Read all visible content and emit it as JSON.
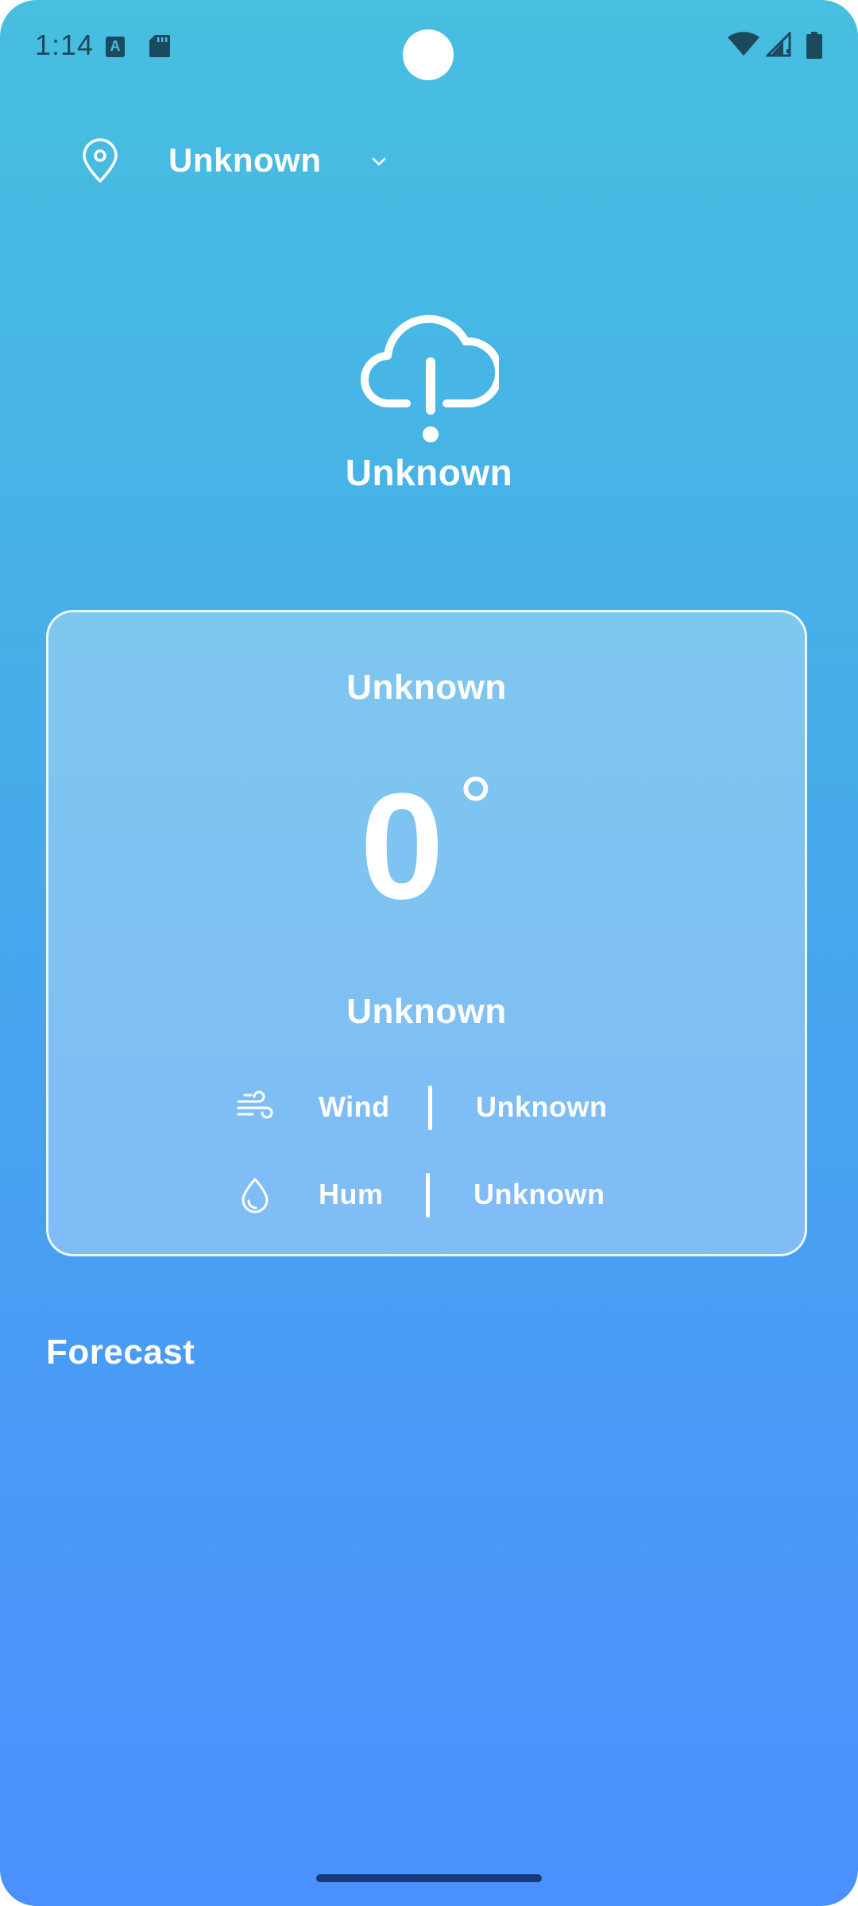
{
  "status_bar": {
    "time": "1:14",
    "keyboard_badge": "A",
    "icons": [
      "sd-card-icon",
      "wifi-icon",
      "signal-icon",
      "battery-icon"
    ],
    "icon_color": "#1b4a5e"
  },
  "header": {
    "location": "Unknown",
    "location_icon": "map-pin-icon",
    "dropdown_icon": "chevron-down-icon"
  },
  "condition": {
    "icon": "cloud-alert-icon",
    "label": "Unknown"
  },
  "card": {
    "top_label": "Unknown",
    "temperature": "0",
    "temperature_unit": "°",
    "bottom_label": "Unknown",
    "metrics": [
      {
        "icon": "wind-icon",
        "label": "Wind",
        "value": "Unknown"
      },
      {
        "icon": "droplet-icon",
        "label": "Hum",
        "value": "Unknown"
      }
    ]
  },
  "forecast": {
    "title": "Forecast"
  },
  "theme": {
    "gradient_top": "#47bfe0",
    "gradient_bottom": "#4a90fe",
    "text_color": "#ffffff"
  }
}
